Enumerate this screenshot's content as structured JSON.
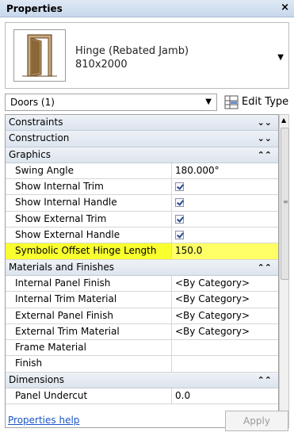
{
  "window": {
    "title": "Properties",
    "close_glyph": "×"
  },
  "type_selector": {
    "name_line1": "Hinge (Rebated Jamb)",
    "name_line2": "810x2000",
    "icon": "door-thumbnail"
  },
  "filter": {
    "value": "Doors (1)"
  },
  "toolbar": {
    "edit_type_label": "Edit Type"
  },
  "categories": {
    "constraints": "Constraints",
    "construction": "Construction",
    "graphics": "Graphics",
    "materials": "Materials and Finishes",
    "dimensions": "Dimensions"
  },
  "graphics": [
    {
      "name": "Swing Angle",
      "value": "180.000°"
    },
    {
      "name": "Show Internal Trim",
      "checked": true
    },
    {
      "name": "Show Internal Handle",
      "checked": true
    },
    {
      "name": "Show External Trim",
      "checked": true
    },
    {
      "name": "Show External Handle",
      "checked": true
    },
    {
      "name": "Symbolic Offset Hinge Length",
      "value": "150.0",
      "highlight_color": "#ffff00"
    }
  ],
  "materials": [
    {
      "name": "Internal Panel Finish",
      "value": "<By Category>"
    },
    {
      "name": "Internal Trim Material",
      "value": "<By Category>"
    },
    {
      "name": "External Panel Finish",
      "value": "<By Category>"
    },
    {
      "name": "External Trim Material",
      "value": "<By Category>"
    },
    {
      "name": "Frame Material",
      "value": ""
    },
    {
      "name": "Finish",
      "value": ""
    }
  ],
  "dimensions": [
    {
      "name": "Panel Undercut",
      "value": "0.0"
    }
  ],
  "footer": {
    "help_link": "Properties help",
    "apply_label": "Apply"
  }
}
